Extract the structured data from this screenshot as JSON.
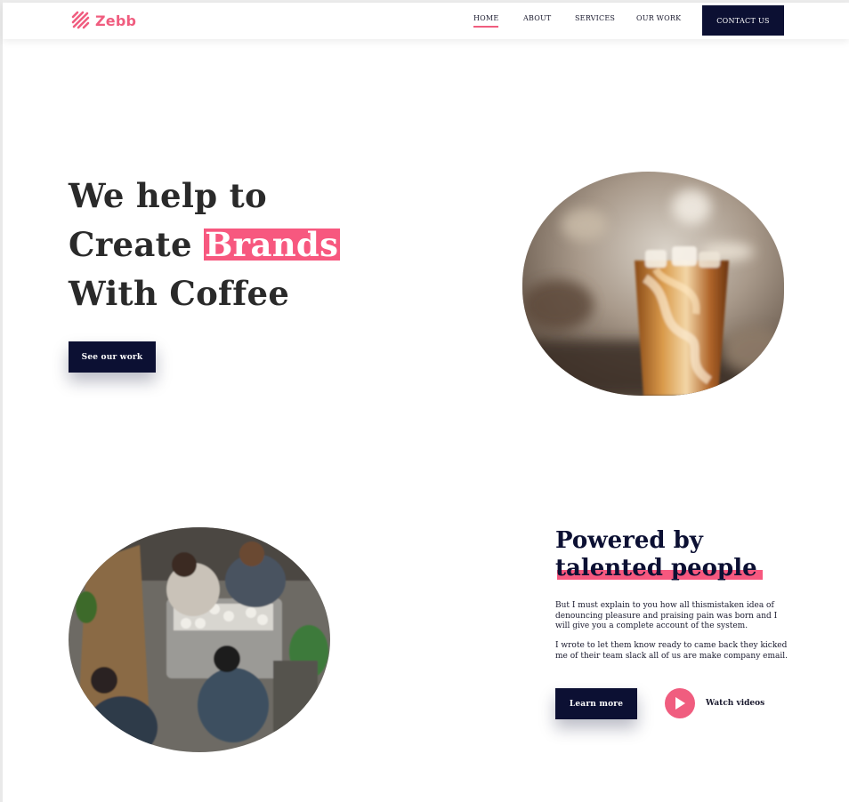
{
  "brand": {
    "name": "Zebb",
    "color": "#f05d7f",
    "logo_icon": "stripes-logo-icon"
  },
  "nav": {
    "items": [
      {
        "label": "HOME",
        "active": true
      },
      {
        "label": "ABOUT",
        "active": false
      },
      {
        "label": "SERVICES",
        "active": false
      },
      {
        "label": "OUR WORK",
        "active": false
      }
    ],
    "contact_label": "CONTACT US"
  },
  "hero": {
    "line1": "We help to",
    "line2_prefix": "Create",
    "line2_highlight": "Brands",
    "line3": "With Coffee",
    "cta_label": "See our work",
    "image": "iced-coffee-photo"
  },
  "about": {
    "title_line1": "Powered by",
    "title_line2": "talented people",
    "paragraph1": "But I must explain to you how all thismistaken idea of denouncing pleasure and praising pain was born and I will give you a complete account of the system.",
    "paragraph2": "I wrote to let them know ready to came back they kicked me of their team slack all of us are make company email.",
    "learn_label": "Learn more",
    "watch_label": "Watch videos",
    "watch_icon": "play-icon",
    "image": "baristas-photo"
  },
  "colors": {
    "accent": "#f7587f",
    "navy": "#0c1033",
    "text": "#2a2a2a"
  }
}
